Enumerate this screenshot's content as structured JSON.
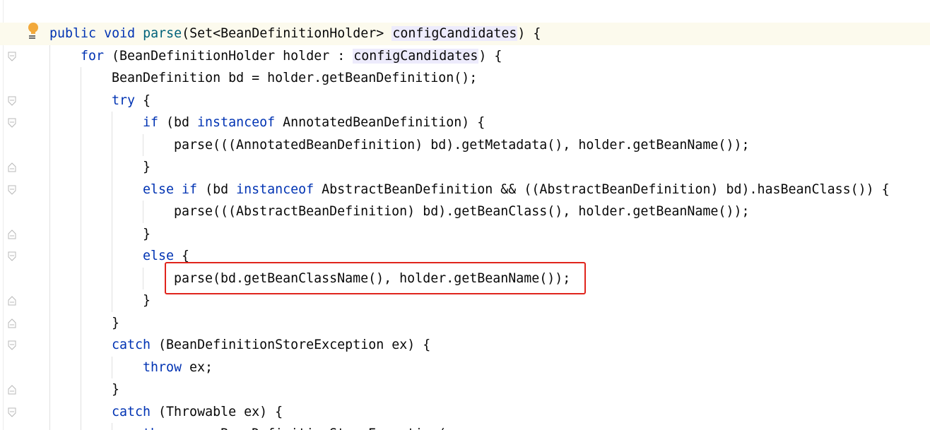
{
  "editor": {
    "lines": [
      {
        "tokens": [
          {
            "t": "public",
            "c": "kw"
          },
          {
            "t": " "
          },
          {
            "t": "void",
            "c": "kw"
          },
          {
            "t": " "
          },
          {
            "t": "parse",
            "c": "fn"
          },
          {
            "t": "(Set<BeanDefinitionHolder> "
          },
          {
            "t": "configCandidates",
            "c": "hl"
          },
          {
            "t": ") {"
          }
        ]
      },
      {
        "tokens": [
          {
            "t": "for",
            "c": "kw"
          },
          {
            "t": " (BeanDefinitionHolder holder : "
          },
          {
            "t": "configCandidates",
            "c": "hl"
          },
          {
            "t": ") {"
          }
        ]
      },
      {
        "tokens": [
          {
            "t": "BeanDefinition bd = holder.getBeanDefinition();"
          }
        ]
      },
      {
        "tokens": [
          {
            "t": "try",
            "c": "kw"
          },
          {
            "t": " {"
          }
        ]
      },
      {
        "tokens": [
          {
            "t": "if",
            "c": "kw"
          },
          {
            "t": " (bd "
          },
          {
            "t": "instanceof",
            "c": "kw"
          },
          {
            "t": " AnnotatedBeanDefinition) {"
          }
        ]
      },
      {
        "tokens": [
          {
            "t": "parse(((AnnotatedBeanDefinition) bd).getMetadata(), holder.getBeanName());"
          }
        ]
      },
      {
        "tokens": [
          {
            "t": "}"
          }
        ]
      },
      {
        "tokens": [
          {
            "t": "else",
            "c": "kw"
          },
          {
            "t": " "
          },
          {
            "t": "if",
            "c": "kw"
          },
          {
            "t": " (bd "
          },
          {
            "t": "instanceof",
            "c": "kw"
          },
          {
            "t": " AbstractBeanDefinition && ((AbstractBeanDefinition) bd).hasBeanClass()) {"
          }
        ]
      },
      {
        "tokens": [
          {
            "t": "parse(((AbstractBeanDefinition) bd).getBeanClass(), holder.getBeanName());"
          }
        ]
      },
      {
        "tokens": [
          {
            "t": "}"
          }
        ]
      },
      {
        "tokens": [
          {
            "t": "else",
            "c": "kw"
          },
          {
            "t": " {"
          }
        ]
      },
      {
        "tokens": [
          {
            "t": "parse(bd.getBeanClassName(), holder.getBeanName());"
          }
        ]
      },
      {
        "tokens": [
          {
            "t": "}"
          }
        ]
      },
      {
        "tokens": [
          {
            "t": "}"
          }
        ]
      },
      {
        "tokens": [
          {
            "t": "catch",
            "c": "kw"
          },
          {
            "t": " (BeanDefinitionStoreException ex) {"
          }
        ]
      },
      {
        "tokens": [
          {
            "t": "throw",
            "c": "kw"
          },
          {
            "t": " ex;"
          }
        ]
      },
      {
        "tokens": [
          {
            "t": "}"
          }
        ]
      },
      {
        "tokens": [
          {
            "t": "catch",
            "c": "kw"
          },
          {
            "t": " (Throwable ex) {"
          }
        ]
      },
      {
        "tokens": [
          {
            "t": "throw",
            "c": "kw"
          },
          {
            "t": " new BeanDefinitionStoreException("
          }
        ]
      }
    ],
    "colors": {
      "keyword": "#0033b3",
      "method_declaration": "#00627a",
      "default_text": "#080808",
      "field_highlight_bg": "#edebfc",
      "current_line_bg": "#fcfaed",
      "annotation_box": "#e0241c"
    },
    "icons": [
      "intention-bulb-icon",
      "fold-toggle-icon"
    ]
  }
}
